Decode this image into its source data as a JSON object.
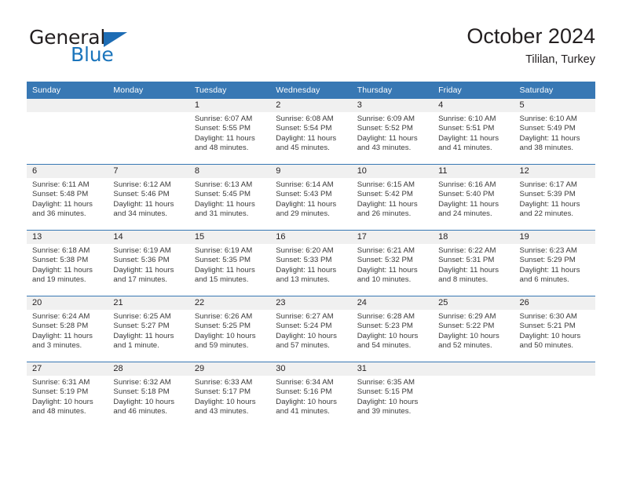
{
  "brand": {
    "name_dark": "General",
    "name_blue": "Blue",
    "triangle_color": "#1d6cb4",
    "blue_color": "#1b75bc"
  },
  "header": {
    "title": "October 2024",
    "location": "Tililan, Turkey"
  },
  "theme": {
    "header_row_bg": "#3878b4",
    "daynum_band_bg": "#f0f0f0",
    "grid_line": "#3878b4",
    "text": "#231f20"
  },
  "weekday_headers": [
    "Sunday",
    "Monday",
    "Tuesday",
    "Wednesday",
    "Thursday",
    "Friday",
    "Saturday"
  ],
  "labels": {
    "sunrise_prefix": "Sunrise:",
    "sunset_prefix": "Sunset:",
    "daylight_prefix": "Daylight:"
  },
  "weeks": [
    [
      {
        "day": "",
        "blank": true,
        "sunrise": "",
        "sunset": "",
        "daylight_line1": "",
        "daylight_line2": ""
      },
      {
        "day": "",
        "blank": true,
        "sunrise": "",
        "sunset": "",
        "daylight_line1": "",
        "daylight_line2": ""
      },
      {
        "day": "1",
        "blank": false,
        "sunrise": "Sunrise: 6:07 AM",
        "sunset": "Sunset: 5:55 PM",
        "daylight_line1": "Daylight: 11 hours",
        "daylight_line2": "and 48 minutes."
      },
      {
        "day": "2",
        "blank": false,
        "sunrise": "Sunrise: 6:08 AM",
        "sunset": "Sunset: 5:54 PM",
        "daylight_line1": "Daylight: 11 hours",
        "daylight_line2": "and 45 minutes."
      },
      {
        "day": "3",
        "blank": false,
        "sunrise": "Sunrise: 6:09 AM",
        "sunset": "Sunset: 5:52 PM",
        "daylight_line1": "Daylight: 11 hours",
        "daylight_line2": "and 43 minutes."
      },
      {
        "day": "4",
        "blank": false,
        "sunrise": "Sunrise: 6:10 AM",
        "sunset": "Sunset: 5:51 PM",
        "daylight_line1": "Daylight: 11 hours",
        "daylight_line2": "and 41 minutes."
      },
      {
        "day": "5",
        "blank": false,
        "sunrise": "Sunrise: 6:10 AM",
        "sunset": "Sunset: 5:49 PM",
        "daylight_line1": "Daylight: 11 hours",
        "daylight_line2": "and 38 minutes."
      }
    ],
    [
      {
        "day": "6",
        "blank": false,
        "sunrise": "Sunrise: 6:11 AM",
        "sunset": "Sunset: 5:48 PM",
        "daylight_line1": "Daylight: 11 hours",
        "daylight_line2": "and 36 minutes."
      },
      {
        "day": "7",
        "blank": false,
        "sunrise": "Sunrise: 6:12 AM",
        "sunset": "Sunset: 5:46 PM",
        "daylight_line1": "Daylight: 11 hours",
        "daylight_line2": "and 34 minutes."
      },
      {
        "day": "8",
        "blank": false,
        "sunrise": "Sunrise: 6:13 AM",
        "sunset": "Sunset: 5:45 PM",
        "daylight_line1": "Daylight: 11 hours",
        "daylight_line2": "and 31 minutes."
      },
      {
        "day": "9",
        "blank": false,
        "sunrise": "Sunrise: 6:14 AM",
        "sunset": "Sunset: 5:43 PM",
        "daylight_line1": "Daylight: 11 hours",
        "daylight_line2": "and 29 minutes."
      },
      {
        "day": "10",
        "blank": false,
        "sunrise": "Sunrise: 6:15 AM",
        "sunset": "Sunset: 5:42 PM",
        "daylight_line1": "Daylight: 11 hours",
        "daylight_line2": "and 26 minutes."
      },
      {
        "day": "11",
        "blank": false,
        "sunrise": "Sunrise: 6:16 AM",
        "sunset": "Sunset: 5:40 PM",
        "daylight_line1": "Daylight: 11 hours",
        "daylight_line2": "and 24 minutes."
      },
      {
        "day": "12",
        "blank": false,
        "sunrise": "Sunrise: 6:17 AM",
        "sunset": "Sunset: 5:39 PM",
        "daylight_line1": "Daylight: 11 hours",
        "daylight_line2": "and 22 minutes."
      }
    ],
    [
      {
        "day": "13",
        "blank": false,
        "sunrise": "Sunrise: 6:18 AM",
        "sunset": "Sunset: 5:38 PM",
        "daylight_line1": "Daylight: 11 hours",
        "daylight_line2": "and 19 minutes."
      },
      {
        "day": "14",
        "blank": false,
        "sunrise": "Sunrise: 6:19 AM",
        "sunset": "Sunset: 5:36 PM",
        "daylight_line1": "Daylight: 11 hours",
        "daylight_line2": "and 17 minutes."
      },
      {
        "day": "15",
        "blank": false,
        "sunrise": "Sunrise: 6:19 AM",
        "sunset": "Sunset: 5:35 PM",
        "daylight_line1": "Daylight: 11 hours",
        "daylight_line2": "and 15 minutes."
      },
      {
        "day": "16",
        "blank": false,
        "sunrise": "Sunrise: 6:20 AM",
        "sunset": "Sunset: 5:33 PM",
        "daylight_line1": "Daylight: 11 hours",
        "daylight_line2": "and 13 minutes."
      },
      {
        "day": "17",
        "blank": false,
        "sunrise": "Sunrise: 6:21 AM",
        "sunset": "Sunset: 5:32 PM",
        "daylight_line1": "Daylight: 11 hours",
        "daylight_line2": "and 10 minutes."
      },
      {
        "day": "18",
        "blank": false,
        "sunrise": "Sunrise: 6:22 AM",
        "sunset": "Sunset: 5:31 PM",
        "daylight_line1": "Daylight: 11 hours",
        "daylight_line2": "and 8 minutes."
      },
      {
        "day": "19",
        "blank": false,
        "sunrise": "Sunrise: 6:23 AM",
        "sunset": "Sunset: 5:29 PM",
        "daylight_line1": "Daylight: 11 hours",
        "daylight_line2": "and 6 minutes."
      }
    ],
    [
      {
        "day": "20",
        "blank": false,
        "sunrise": "Sunrise: 6:24 AM",
        "sunset": "Sunset: 5:28 PM",
        "daylight_line1": "Daylight: 11 hours",
        "daylight_line2": "and 3 minutes."
      },
      {
        "day": "21",
        "blank": false,
        "sunrise": "Sunrise: 6:25 AM",
        "sunset": "Sunset: 5:27 PM",
        "daylight_line1": "Daylight: 11 hours",
        "daylight_line2": "and 1 minute."
      },
      {
        "day": "22",
        "blank": false,
        "sunrise": "Sunrise: 6:26 AM",
        "sunset": "Sunset: 5:25 PM",
        "daylight_line1": "Daylight: 10 hours",
        "daylight_line2": "and 59 minutes."
      },
      {
        "day": "23",
        "blank": false,
        "sunrise": "Sunrise: 6:27 AM",
        "sunset": "Sunset: 5:24 PM",
        "daylight_line1": "Daylight: 10 hours",
        "daylight_line2": "and 57 minutes."
      },
      {
        "day": "24",
        "blank": false,
        "sunrise": "Sunrise: 6:28 AM",
        "sunset": "Sunset: 5:23 PM",
        "daylight_line1": "Daylight: 10 hours",
        "daylight_line2": "and 54 minutes."
      },
      {
        "day": "25",
        "blank": false,
        "sunrise": "Sunrise: 6:29 AM",
        "sunset": "Sunset: 5:22 PM",
        "daylight_line1": "Daylight: 10 hours",
        "daylight_line2": "and 52 minutes."
      },
      {
        "day": "26",
        "blank": false,
        "sunrise": "Sunrise: 6:30 AM",
        "sunset": "Sunset: 5:21 PM",
        "daylight_line1": "Daylight: 10 hours",
        "daylight_line2": "and 50 minutes."
      }
    ],
    [
      {
        "day": "27",
        "blank": false,
        "sunrise": "Sunrise: 6:31 AM",
        "sunset": "Sunset: 5:19 PM",
        "daylight_line1": "Daylight: 10 hours",
        "daylight_line2": "and 48 minutes."
      },
      {
        "day": "28",
        "blank": false,
        "sunrise": "Sunrise: 6:32 AM",
        "sunset": "Sunset: 5:18 PM",
        "daylight_line1": "Daylight: 10 hours",
        "daylight_line2": "and 46 minutes."
      },
      {
        "day": "29",
        "blank": false,
        "sunrise": "Sunrise: 6:33 AM",
        "sunset": "Sunset: 5:17 PM",
        "daylight_line1": "Daylight: 10 hours",
        "daylight_line2": "and 43 minutes."
      },
      {
        "day": "30",
        "blank": false,
        "sunrise": "Sunrise: 6:34 AM",
        "sunset": "Sunset: 5:16 PM",
        "daylight_line1": "Daylight: 10 hours",
        "daylight_line2": "and 41 minutes."
      },
      {
        "day": "31",
        "blank": false,
        "sunrise": "Sunrise: 6:35 AM",
        "sunset": "Sunset: 5:15 PM",
        "daylight_line1": "Daylight: 10 hours",
        "daylight_line2": "and 39 minutes."
      },
      {
        "day": "",
        "blank": true,
        "sunrise": "",
        "sunset": "",
        "daylight_line1": "",
        "daylight_line2": ""
      },
      {
        "day": "",
        "blank": true,
        "sunrise": "",
        "sunset": "",
        "daylight_line1": "",
        "daylight_line2": ""
      }
    ]
  ]
}
